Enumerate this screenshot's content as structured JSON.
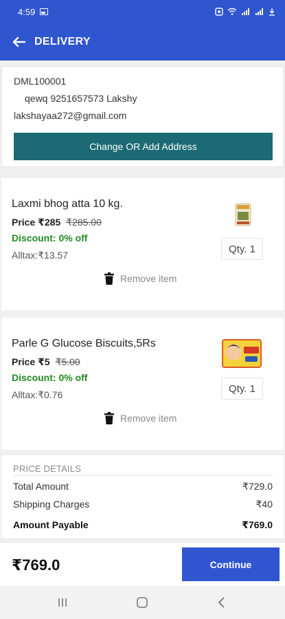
{
  "status_bar": {
    "time": "4:59"
  },
  "header": {
    "title": "DELIVERY"
  },
  "address": {
    "id": "DML100001",
    "contact": "qewq 9251657573 Lakshy",
    "email": "lakshayaa272@gmail.com",
    "button_label": "Change OR Add Address"
  },
  "items": [
    {
      "name": "Laxmi bhog atta 10 kg.",
      "price": "Price ₹285",
      "mrp": "₹285.00",
      "discount": "Discount: 0% off",
      "tax": "Alltax:₹13.57",
      "qty": "Qty. 1",
      "remove_label": "Remove item"
    },
    {
      "name": "Parle G Glucose Biscuits,5Rs",
      "price": "Price ₹5",
      "mrp": "₹5.00",
      "discount": "Discount: 0% off",
      "tax": "Alltax:₹0.76",
      "qty": "Qty. 1",
      "remove_label": "Remove item"
    }
  ],
  "price_details": {
    "header": "PRICE DETAILS",
    "rows": [
      {
        "label": "Total Amount",
        "value": "₹729.0"
      },
      {
        "label": "Shipping Charges",
        "value": "₹40"
      },
      {
        "label": "Amount Payable",
        "value": "₹769.0"
      }
    ]
  },
  "footer": {
    "total": "₹769.0",
    "continue_label": "Continue"
  },
  "colors": {
    "primary": "#2f55cf",
    "address_button": "#1c6a73",
    "discount": "#1f8a1f"
  }
}
